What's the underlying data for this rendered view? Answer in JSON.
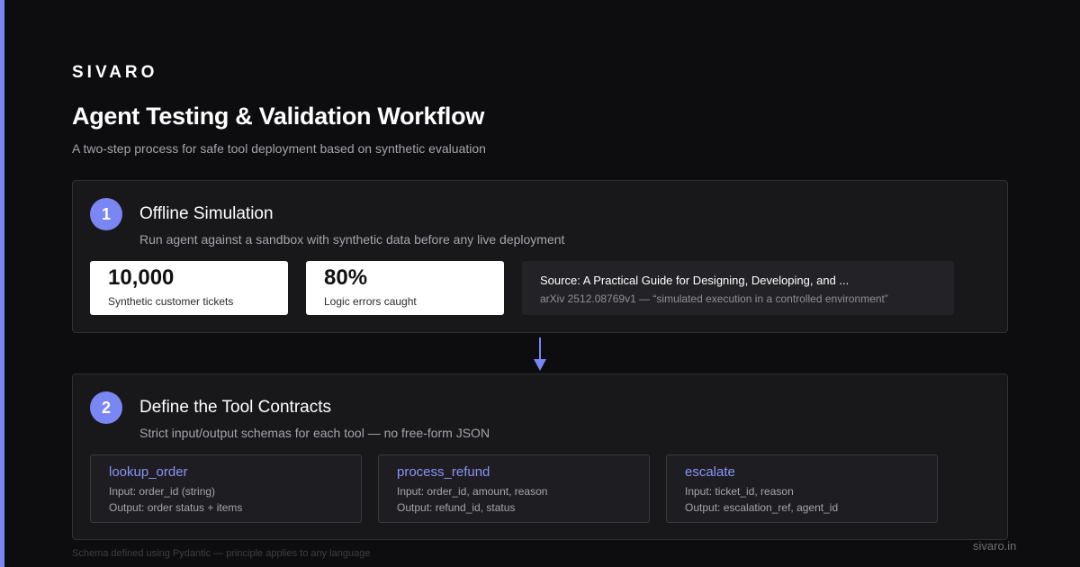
{
  "brand": "SIVARO",
  "title": "Agent Testing & Validation Workflow",
  "subtitle": "A two-step process for safe tool deployment based on synthetic evaluation",
  "colors": {
    "accent": "#7b86f5",
    "background": "#0d0d0f",
    "card": "#18181b",
    "tool_name": "#8a93f7"
  },
  "step1": {
    "number": "1",
    "title": "Offline Simulation",
    "subtitle": "Run agent against a sandbox with synthetic data before any live deployment",
    "stats": [
      {
        "value": "10,000",
        "label": "Synthetic customer tickets"
      },
      {
        "value": "80%",
        "label": "Logic errors caught"
      }
    ],
    "source": {
      "title": "Source: A Practical Guide for Designing, Developing, and ...",
      "citation": "arXiv 2512.08769v1 — “simulated execution in a controlled environment”"
    }
  },
  "connector": {
    "icon": "arrow-down-icon"
  },
  "step2": {
    "number": "2",
    "title": "Define the Tool Contracts",
    "subtitle": "Strict input/output schemas for each tool — no free-form JSON",
    "tools": [
      {
        "name": "lookup_order",
        "input": "Input: order_id (string)",
        "output": "Output: order status + items"
      },
      {
        "name": "process_refund",
        "input": "Input: order_id, amount, reason",
        "output": "Output: refund_id, status"
      },
      {
        "name": "escalate",
        "input": "Input: ticket_id, reason",
        "output": "Output: escalation_ref, agent_id"
      }
    ]
  },
  "footnote": "Schema defined using Pydantic — principle applies to any language",
  "site": "sivaro.in"
}
